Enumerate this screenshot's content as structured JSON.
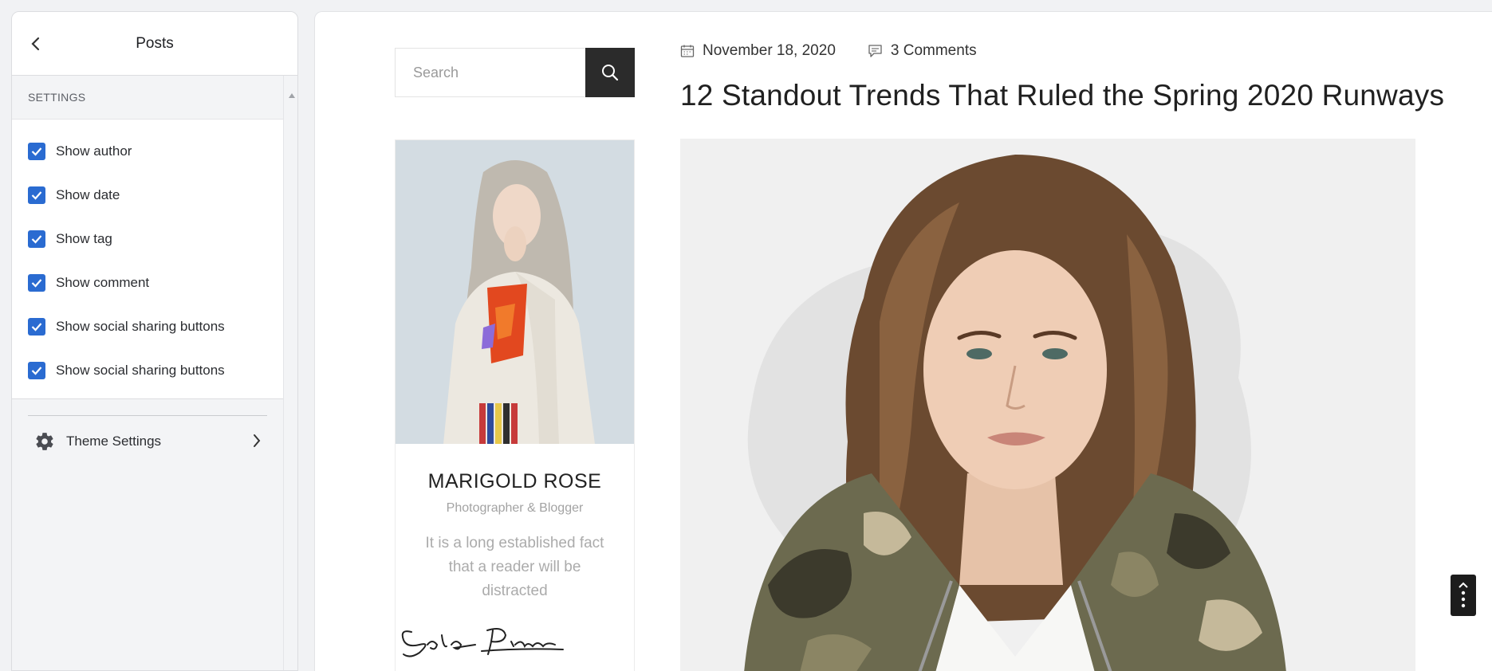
{
  "panel": {
    "title": "Posts",
    "section_label": "SETTINGS",
    "options": [
      {
        "label": "Show author",
        "checked": true
      },
      {
        "label": "Show date",
        "checked": true
      },
      {
        "label": "Show tag",
        "checked": true
      },
      {
        "label": "Show comment",
        "checked": true
      },
      {
        "label": "Show social sharing buttons",
        "checked": true
      },
      {
        "label": "Show social sharing buttons",
        "checked": true
      }
    ],
    "theme_settings_label": "Theme Settings"
  },
  "preview": {
    "search": {
      "placeholder": "Search"
    },
    "author": {
      "name": "MARIGOLD ROSE",
      "role": "Photographer & Blogger",
      "bio": "It is a long established fact that a reader will be distracted",
      "signature": "Solo Pine"
    },
    "post": {
      "date": "November 18, 2020",
      "comments": "3 Comments",
      "title": "12 Standout Trends That Ruled the Spring 2020 Runways"
    }
  },
  "colors": {
    "checkbox": "#2a6bd1",
    "search_button": "#2b2b2b",
    "scroll_top_button": "#1c1c1c"
  }
}
